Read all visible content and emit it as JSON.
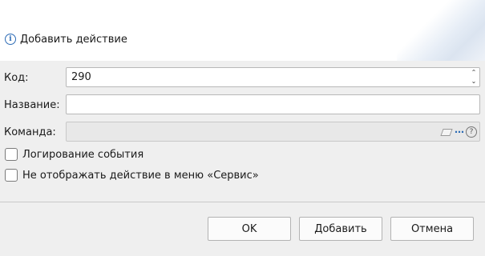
{
  "dialog": {
    "title": "Добавить действие",
    "icon": "info-icon"
  },
  "form": {
    "code": {
      "label": "Код:",
      "value": "290"
    },
    "name": {
      "label": "Название:",
      "value": ""
    },
    "command": {
      "label": "Команда:",
      "value": "",
      "dots": "⋯",
      "help": "?"
    }
  },
  "checkboxes": [
    {
      "label": "Логирование события",
      "checked": false
    },
    {
      "label": "Не отображать действие в меню «Сервис»",
      "checked": false
    }
  ],
  "buttons": {
    "ok": "OK",
    "add": "Добавить",
    "cancel": "Отмена"
  }
}
